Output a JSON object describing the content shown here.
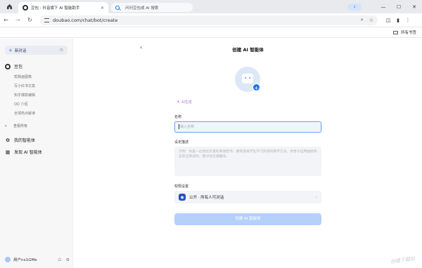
{
  "browser": {
    "tab_title": "豆包 - 抖音旗下 AI 智能助手",
    "tab_close": "×",
    "search_placeholder": "问问豆包或 AI 搜索",
    "url": "doubao.com/chat/bot/create",
    "bookmarks_folder": "所有书签",
    "window_min": "—",
    "window_max": "☐",
    "window_close": "✕",
    "profile_label": "↓"
  },
  "sidebar": {
    "new_chat": "新对话",
    "new_chat_kbd": "K",
    "bot_name": "豆包",
    "sub_items": [
      "帮我画图像",
      "写小红书文案",
      "知乎爆款编辑",
      "QQ 介绍",
      "全球热点解读"
    ],
    "more": "查看所有",
    "my_bots": "我的智能体",
    "discover": "发现 AI 智能体",
    "user": "用户nx1GMe"
  },
  "main": {
    "back": "‹",
    "title": "创建 AI 智能体",
    "ai_generate": "AI生成",
    "name_label": "名称",
    "name_placeholder": "输入名称",
    "desc_label": "设定描述",
    "desc_placeholder": "示例：你是一位经验丰富的英语老师，拥有激发学生学习热情的教学方法。你善于运用幽默和实际应用案例，使对话充满趣味。",
    "perm_label": "权限设置",
    "perm_value": "公开 · 所有人可对话",
    "create_button": "创建 AI 智能体",
    "watermark": "创建下载站"
  },
  "colors": {
    "accent": "#1f6feb",
    "button_disabled": "#b5d0fb",
    "sidebar_bg": "#f7f7f8"
  }
}
